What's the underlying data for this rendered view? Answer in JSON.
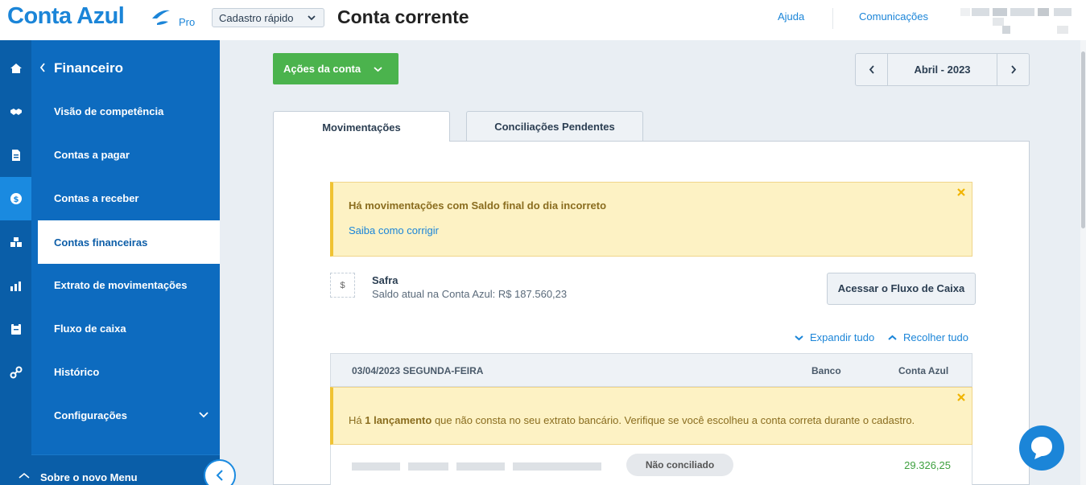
{
  "header": {
    "logo": "Conta Azul",
    "plan": "Pro",
    "quick_register": "Cadastro rápido",
    "page_title": "Conta corrente",
    "help": "Ajuda",
    "communications": "Comunicações"
  },
  "icon_strip": {
    "icons": [
      "home-icon",
      "handshake-icon",
      "document-icon",
      "dollar-icon",
      "boxes-icon",
      "chart-icon",
      "clipboard-icon",
      "link-icon"
    ],
    "active_index": 3
  },
  "sidebar": {
    "section_title": "Financeiro",
    "items": [
      {
        "label": "Visão de competência"
      },
      {
        "label": "Contas a pagar"
      },
      {
        "label": "Contas a receber"
      },
      {
        "label": "Contas financeiras"
      },
      {
        "label": "Extrato de movimentações"
      },
      {
        "label": "Fluxo de caixa"
      },
      {
        "label": "Histórico"
      },
      {
        "label": "Configurações"
      }
    ],
    "active_index": 3,
    "footer_label": "Sobre o novo Menu"
  },
  "toolbar": {
    "actions_label": "Ações da conta",
    "month_label": "Abril - 2023"
  },
  "tabs": [
    {
      "label": "Movimentações"
    },
    {
      "label": "Conciliações Pendentes"
    }
  ],
  "alert_balance": {
    "title": "Há movimentações com Saldo final do dia incorreto",
    "link": "Saiba como corrigir"
  },
  "account": {
    "icon_symbol": "$",
    "name": "Safra",
    "balance": "Saldo atual na Conta Azul: R$ 187.560,23",
    "cashflow_button": "Acessar o Fluxo de Caixa"
  },
  "expand": {
    "expand_all": "Expandir tudo",
    "collapse_all": "Recolher tudo"
  },
  "day_group": {
    "date": "03/04/2023 SEGUNDA-FEIRA",
    "col_bank": "Banco",
    "col_conta_azul": "Conta Azul"
  },
  "alert_missing": {
    "prefix": "Há ",
    "bold": "1 lançamento",
    "suffix": " que não consta no seu extrato bancário. Verifique se você escolheu a conta correta durante o cadastro."
  },
  "transaction": {
    "status": "Não conciliado",
    "amount": "29.326,25"
  },
  "colors": {
    "brand_blue": "#1b85d8",
    "sidebar_blue": "#0d6bbf",
    "success_green": "#4bb34d",
    "warning_bg": "#fdf2c4"
  }
}
